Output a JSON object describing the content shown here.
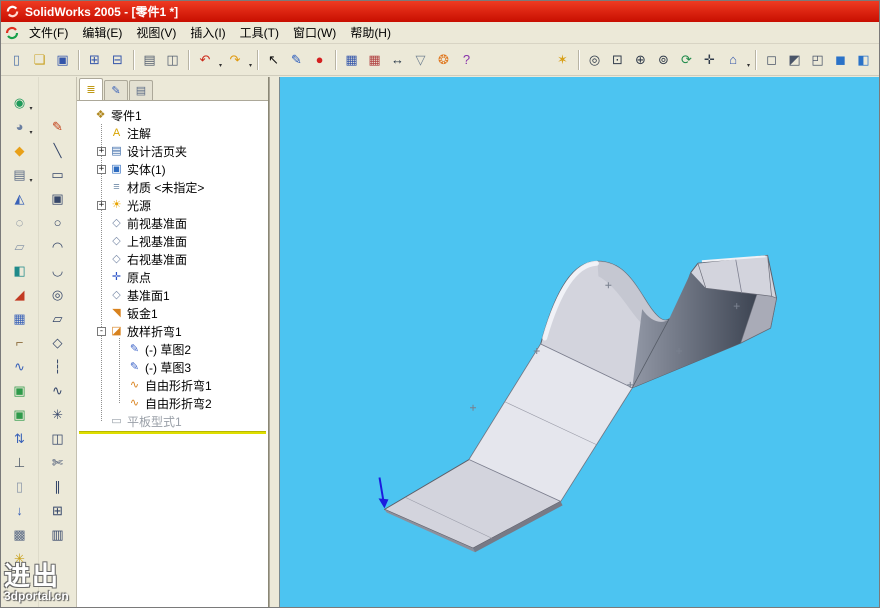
{
  "window": {
    "title": "SolidWorks 2005 - [零件1 *]"
  },
  "colors": {
    "titlebar_red": "#d21202",
    "chrome_gray": "#ece9d8",
    "viewport_blue": "#4cc4f1",
    "part_light": "#d3d4dd",
    "part_bright": "#e5e6ed",
    "part_midshade": "#c2c4cf",
    "part_shadow_light": "#9298a6",
    "part_shadow_dark": "#3d4452",
    "part_flange": "#a9abb7",
    "part_edge": "#5d5f69",
    "highlight_white": "#f4f5f9",
    "rollback_yellow": "#dede00",
    "origin_arrow_blue": "#1c1cdf"
  },
  "menubar": {
    "items": [
      {
        "name": "menu-file",
        "label": "文件(F)"
      },
      {
        "name": "menu-edit",
        "label": "编辑(E)"
      },
      {
        "name": "menu-view",
        "label": "视图(V)"
      },
      {
        "name": "menu-insert",
        "label": "插入(I)"
      },
      {
        "name": "menu-tools",
        "label": "工具(T)"
      },
      {
        "name": "menu-window",
        "label": "窗口(W)"
      },
      {
        "name": "menu-help",
        "label": "帮助(H)"
      }
    ]
  },
  "toolbar_top": {
    "left_items": [
      {
        "name": "new-document-icon",
        "glyph": "▯",
        "color": "#5577aa"
      },
      {
        "name": "open-folder-icon",
        "glyph": "❏",
        "color": "#c8a020"
      },
      {
        "name": "save-icon",
        "glyph": "▣",
        "color": "#3355aa"
      },
      {
        "name": "toolbar-separator",
        "sep": true
      },
      {
        "name": "make-drawing-icon",
        "glyph": "⊞",
        "color": "#3355aa"
      },
      {
        "name": "make-assembly-icon",
        "glyph": "⊟",
        "color": "#3355aa"
      },
      {
        "name": "toolbar-separator",
        "sep": true
      },
      {
        "name": "print-icon",
        "glyph": "▤",
        "color": "#556070"
      },
      {
        "name": "print-preview-icon",
        "glyph": "◫",
        "color": "#556070"
      },
      {
        "name": "toolbar-separator",
        "sep": true
      },
      {
        "name": "undo-icon",
        "glyph": "↶",
        "color": "#cc2a1a",
        "dd": true
      },
      {
        "name": "redo-icon",
        "glyph": "↷",
        "color": "#e09a10",
        "dd": true
      },
      {
        "name": "toolbar-separator",
        "sep": true
      },
      {
        "name": "select-cursor-icon",
        "glyph": "↖",
        "color": "#101010"
      },
      {
        "name": "sketch-pencil-icon",
        "glyph": "✎",
        "color": "#2255bb"
      },
      {
        "name": "red-sphere-icon",
        "glyph": "●",
        "color": "#d42020"
      },
      {
        "name": "toolbar-separator",
        "sep": true
      },
      {
        "name": "design-table-icon",
        "glyph": "▦",
        "color": "#3355aa"
      },
      {
        "name": "excel-table-icon",
        "glyph": "▦",
        "color": "#b04040"
      },
      {
        "name": "dimension-icon",
        "glyph": "↔",
        "color": "#223344"
      },
      {
        "name": "selection-filter-icon",
        "glyph": "▽",
        "color": "#708090"
      },
      {
        "name": "appearance-icon",
        "glyph": "❂",
        "color": "#e07820"
      },
      {
        "name": "help-icon",
        "glyph": "?",
        "color": "#8833aa"
      }
    ],
    "right_items": [
      {
        "name": "magic-wand-icon",
        "glyph": "✶",
        "color": "#d8a018"
      },
      {
        "name": "toolbar-separator",
        "sep": true
      },
      {
        "name": "zoom-to-fit-icon",
        "glyph": "◎",
        "color": "#303b4a"
      },
      {
        "name": "zoom-to-area-icon",
        "glyph": "⊡",
        "color": "#303b4a"
      },
      {
        "name": "zoom-in-out-icon",
        "glyph": "⊕",
        "color": "#303b4a"
      },
      {
        "name": "zoom-to-selection-icon",
        "glyph": "⊚",
        "color": "#303b4a"
      },
      {
        "name": "rotate-view-icon",
        "glyph": "⟳",
        "color": "#1f8a4a"
      },
      {
        "name": "pan-icon",
        "glyph": "✛",
        "color": "#303b4a"
      },
      {
        "name": "standard-views-icon",
        "glyph": "⌂",
        "color": "#3355aa",
        "dd": true
      },
      {
        "name": "toolbar-separator",
        "sep": true
      },
      {
        "name": "wireframe-icon",
        "glyph": "◻",
        "color": "#4a5568"
      },
      {
        "name": "hidden-lines-visible-icon",
        "glyph": "◩",
        "color": "#4a5568"
      },
      {
        "name": "hidden-lines-removed-icon",
        "glyph": "◰",
        "color": "#4a5568"
      },
      {
        "name": "shaded-icon",
        "glyph": "◼",
        "color": "#2a72c8"
      },
      {
        "name": "section-view-icon",
        "glyph": "◧",
        "color": "#2a72c8"
      }
    ]
  },
  "toolbar_side1": {
    "items": [
      {
        "name": "green-sphere-tool-icon",
        "glyph": "◉",
        "color": "#1e9a5a",
        "dd": true
      },
      {
        "name": "shaded-sphere-tool-icon",
        "glyph": "◕",
        "color": "#6a7ea0",
        "dd": true
      },
      {
        "name": "orange-diamond-tool-icon",
        "glyph": "◆",
        "color": "#e8a018"
      },
      {
        "name": "panel-grid-tool-icon",
        "glyph": "▤",
        "color": "#5a6a85",
        "dd": true
      },
      {
        "name": "blue-wedge-tool-icon",
        "glyph": "◭",
        "color": "#3a62b8"
      },
      {
        "name": "ring-tool-icon",
        "glyph": "◌",
        "color": "#5a6a85"
      },
      {
        "name": "pale-sheet-tool-icon",
        "glyph": "▱",
        "color": "#8c98aa"
      },
      {
        "name": "teal-box-tool-icon",
        "glyph": "◧",
        "color": "#1f8a8a"
      },
      {
        "name": "red-wedge-tool-icon",
        "glyph": "◢",
        "color": "#c23a22"
      },
      {
        "name": "blue-grid-tool-icon",
        "glyph": "▦",
        "color": "#3a62b8"
      },
      {
        "name": "bent-bar-tool-icon",
        "glyph": "⌐",
        "color": "#8a6a3a"
      },
      {
        "name": "wave-tool-icon",
        "glyph": "∿",
        "color": "#3a62b8"
      },
      {
        "name": "green-panel-tool-icon",
        "glyph": "▣",
        "color": "#2f9a4a"
      },
      {
        "name": "green-panel-tool-icon-2",
        "glyph": "▣",
        "color": "#2f9a4a"
      },
      {
        "name": "swap-arrows-tool-icon",
        "glyph": "⇅",
        "color": "#3a62b8"
      },
      {
        "name": "tee-tool-icon",
        "glyph": "⊥",
        "color": "#55606e"
      },
      {
        "name": "pale-page-tool-icon",
        "glyph": "▯",
        "color": "#8c98aa"
      },
      {
        "name": "down-arrow-tool-icon",
        "glyph": "↓",
        "color": "#3a62b8"
      },
      {
        "name": "hatch-tool-icon",
        "glyph": "▩",
        "color": "#5a6a85"
      },
      {
        "name": "star-tool-icon",
        "glyph": "✳",
        "color": "#c8a018"
      }
    ]
  },
  "toolbar_side2": {
    "items": [
      {
        "name": "sketch-flag-icon",
        "glyph": "✎",
        "color": "#c24018"
      },
      {
        "name": "line-tool-icon",
        "glyph": "╲",
        "color": "#36476a"
      },
      {
        "name": "rectangle-tool-icon",
        "glyph": "▭",
        "color": "#36476a"
      },
      {
        "name": "center-rectangle-tool-icon",
        "glyph": "▣",
        "color": "#36476a"
      },
      {
        "name": "circle-tool-icon",
        "glyph": "○",
        "color": "#36476a"
      },
      {
        "name": "arc-tool-icon",
        "glyph": "◠",
        "color": "#36476a"
      },
      {
        "name": "tangent-arc-tool-icon",
        "glyph": "◡",
        "color": "#36476a"
      },
      {
        "name": "ellipse-tool-icon",
        "glyph": "◎",
        "color": "#36476a"
      },
      {
        "name": "parallelogram-tool-icon",
        "glyph": "▱",
        "color": "#36476a"
      },
      {
        "name": "polygon-tool-icon",
        "glyph": "◇",
        "color": "#36476a"
      },
      {
        "name": "centerline-tool-icon",
        "glyph": "┆",
        "color": "#36476a"
      },
      {
        "name": "spline-tool-icon",
        "glyph": "∿",
        "color": "#36476a"
      },
      {
        "name": "point-tool-icon",
        "glyph": "✳",
        "color": "#36476a"
      },
      {
        "name": "mirror-tool-icon",
        "glyph": "◫",
        "color": "#36476a"
      },
      {
        "name": "trim-tool-icon",
        "glyph": "✄",
        "color": "#36476a"
      },
      {
        "name": "offset-tool-icon",
        "glyph": "∥",
        "color": "#36476a"
      },
      {
        "name": "convert-entities-tool-icon",
        "glyph": "⊞",
        "color": "#36476a"
      },
      {
        "name": "linear-pattern-tool-icon",
        "glyph": "▥",
        "color": "#36476a"
      }
    ]
  },
  "feature_panel": {
    "tabs": [
      {
        "name": "featuremanager-tab",
        "glyph": "≣",
        "color": "#c09a18",
        "active": true
      },
      {
        "name": "propertymanager-tab",
        "glyph": "✎",
        "color": "#3a62b8"
      },
      {
        "name": "configurationmanager-tab",
        "glyph": "▤",
        "color": "#5a6a85"
      }
    ],
    "items": [
      {
        "name": "tree-item-part-root",
        "label": "零件1",
        "icon": "part-icon",
        "glyph": "❖",
        "iconColor": "#b08820",
        "expander": "",
        "indent": 0
      },
      {
        "name": "tree-item-annotations",
        "label": "注解",
        "icon": "annotations-icon",
        "glyph": "A",
        "iconColor": "#d8a400",
        "expander": "",
        "indent": 1
      },
      {
        "name": "tree-item-design-binder",
        "label": "设计活页夹",
        "icon": "design-binder-icon",
        "glyph": "▤",
        "iconColor": "#3a6aa8",
        "expander": "+",
        "indent": 1
      },
      {
        "name": "tree-item-solid-bodies",
        "label": "实体(1)",
        "icon": "solid-bodies-folder-icon",
        "glyph": "▣",
        "iconColor": "#2e6cc0",
        "expander": "+",
        "indent": 1
      },
      {
        "name": "tree-item-material",
        "label": "材质 <未指定>",
        "icon": "material-icon",
        "glyph": "≡",
        "iconColor": "#708ba8",
        "expander": "",
        "indent": 1
      },
      {
        "name": "tree-item-lighting",
        "label": "光源",
        "icon": "lighting-folder-icon",
        "glyph": "☀",
        "iconColor": "#e8a400",
        "expander": "+",
        "indent": 1
      },
      {
        "name": "tree-item-front-plane",
        "label": "前视基准面",
        "icon": "plane-icon",
        "glyph": "◇",
        "iconColor": "#7a8ba8",
        "expander": "",
        "indent": 1
      },
      {
        "name": "tree-item-top-plane",
        "label": "上视基准面",
        "icon": "plane-icon",
        "glyph": "◇",
        "iconColor": "#7a8ba8",
        "expander": "",
        "indent": 1
      },
      {
        "name": "tree-item-right-plane",
        "label": "右视基准面",
        "icon": "plane-icon",
        "glyph": "◇",
        "iconColor": "#7a8ba8",
        "expander": "",
        "indent": 1
      },
      {
        "name": "tree-item-origin",
        "label": "原点",
        "icon": "origin-icon",
        "glyph": "✛",
        "iconColor": "#2a52c8",
        "expander": "",
        "indent": 1
      },
      {
        "name": "tree-item-plane1",
        "label": "基准面1",
        "icon": "plane-icon",
        "glyph": "◇",
        "iconColor": "#7a8ba8",
        "expander": "",
        "indent": 1
      },
      {
        "name": "tree-item-sheet-metal1",
        "label": "钣金1",
        "icon": "sheet-metal-icon",
        "glyph": "◥",
        "iconColor": "#d8821e",
        "expander": "",
        "indent": 1
      },
      {
        "name": "tree-item-lofted-bend1",
        "label": "放样折弯1",
        "icon": "lofted-bend-icon",
        "glyph": "◪",
        "iconColor": "#d8821e",
        "expander": "-",
        "indent": 1
      },
      {
        "name": "tree-item-sketch2",
        "label": "(-) 草图2",
        "icon": "sketch-icon",
        "glyph": "✎",
        "iconColor": "#3a62c8",
        "expander": "",
        "indent": 2
      },
      {
        "name": "tree-item-sketch3",
        "label": "(-) 草图3",
        "icon": "sketch-icon",
        "glyph": "✎",
        "iconColor": "#3a62c8",
        "expander": "",
        "indent": 2
      },
      {
        "name": "tree-item-freeform-bend1",
        "label": "自由形折弯1",
        "icon": "freeform-bend-icon",
        "glyph": "∿",
        "iconColor": "#d8821e",
        "expander": "",
        "indent": 2
      },
      {
        "name": "tree-item-freeform-bend2",
        "label": "自由形折弯2",
        "icon": "freeform-bend-icon",
        "glyph": "∿",
        "iconColor": "#d8821e",
        "expander": "",
        "indent": 2
      },
      {
        "name": "tree-item-flat-pattern1",
        "label": "平板型式1",
        "icon": "flat-pattern-icon",
        "glyph": "▭",
        "iconColor": "#98a0a8",
        "expander": "",
        "indent": 1,
        "grayed": true
      }
    ]
  },
  "watermark": {
    "line1": "进出",
    "line2": "3dportal.cn"
  }
}
